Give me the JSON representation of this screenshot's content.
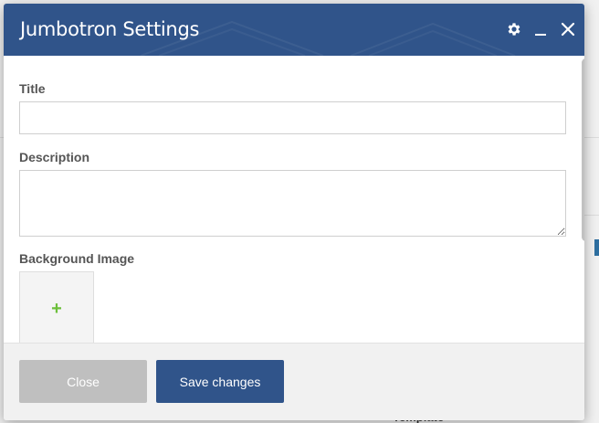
{
  "modal": {
    "title": "Jumbotron Settings",
    "icons": {
      "settings": "gear-icon",
      "minimize": "minimize-icon",
      "close": "close-icon"
    }
  },
  "fields": {
    "title_label": "Title",
    "title_value": "",
    "description_label": "Description",
    "description_value": "",
    "background_image_label": "Background Image",
    "add_image_icon": "+"
  },
  "footer": {
    "close_label": "Close",
    "save_label": "Save changes"
  },
  "background": {
    "template_text": "Template"
  },
  "colors": {
    "header": "#30548a",
    "primary_button": "#30548a",
    "secondary_button": "#bfbfbf",
    "add_icon": "#6cbf3a"
  }
}
